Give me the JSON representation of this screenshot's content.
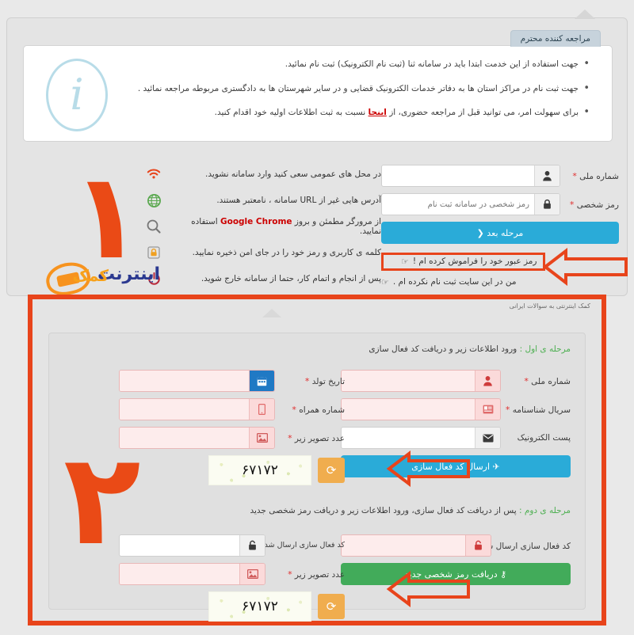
{
  "header": {
    "info_tab_title": "مراجعه کننده محترم",
    "info_icon": "info-circle-icon",
    "bullets": [
      "جهت استفاده از این خدمت ابتدا باید در سامانه ثنا (ثبت نام الکترونیک) ثبت نام نمائید.",
      "جهت ثبت نام در مراکز استان ها به دفاتر خدمات الکترونیک قضایی و در سایر شهرستان ها به دادگستری مربوطه مراجعه نمائید .",
      "برای سهولت امر، می توانید قبل از مراجعه حضوری، از اینجا نسبت به ثبت اطلاعات اولیه خود اقدام کنید."
    ],
    "bullet3_prefix": "برای سهولت امر، می توانید قبل از مراجعه حضوری، از ",
    "bullet3_link": "اینجا",
    "bullet3_suffix": " نسبت به ثبت اطلاعات اولیه خود اقدام کنید."
  },
  "tips": [
    {
      "icon": "wifi-icon",
      "text": "در محل های عمومی سعی کنید وارد سامانه نشوید."
    },
    {
      "icon": "globe-icon",
      "text": "آدرس هایی غیر از URL سامانه ، نامعتبر هستند."
    },
    {
      "icon": "magnifier-icon",
      "prefix": "از مرورگر مطمئن و بروز ",
      "brand": "Google Chrome",
      "suffix": " استفاده نمایید."
    },
    {
      "icon": "lock-icon",
      "text": "کلمه ی کاربری و رمز خود را در جای امن ذخیره نمایید."
    },
    {
      "icon": "power-icon",
      "text": "پس از انجام و اتمام کار، حتما از سامانه خارج شوید."
    }
  ],
  "login": {
    "fields": [
      {
        "label": "شماره ملی",
        "required": true,
        "icon": "user-icon",
        "value": "",
        "placeholder": ""
      },
      {
        "label": "رمز شخصی",
        "required": true,
        "icon": "lock-icon",
        "value": "",
        "placeholder": "رمز شخصی در سامانه ثبت نام"
      }
    ],
    "next_button": "مرحله بعد",
    "next_button_chevron": "❮",
    "next_button_color": "#2aabd8",
    "forgot_link": "رمز عبور خود را فراموش کرده ام !",
    "not_registered_link": "من در این سایت ثبت نام نکرده ام .",
    "hand_icon": "pointing-hand-icon"
  },
  "watermark": {
    "brand": "اینترنت",
    "brand_k": "کمک",
    "tagline": "کمک اینترنتی به سوالات ایرانی",
    "icon": "swoosh-logo-icon"
  },
  "big_numerals": {
    "one": "۱",
    "two": "۲"
  },
  "stage1": {
    "heading_label": "مرحله ی اول :",
    "heading_text": " ورود اطلاعات زیر و دریافت کد فعال سازی",
    "right_fields": [
      {
        "label": "شماره ملی",
        "required": true,
        "icon": "user-icon",
        "value": "",
        "state": "pink"
      },
      {
        "label": "سریال شناسنامه",
        "required": true,
        "icon": "id-card-icon",
        "value": "",
        "state": "pink"
      },
      {
        "label": "پست الکترونیک",
        "required": false,
        "icon": "envelope-icon",
        "value": "",
        "state": "white"
      }
    ],
    "left_fields": [
      {
        "label": "تاریخ تولد",
        "required": true,
        "icon": "calendar-icon",
        "value": "",
        "state": "pink",
        "addon": "blue"
      },
      {
        "label": "شماره همراه",
        "required": true,
        "icon": "mobile-icon",
        "value": "",
        "state": "pink"
      },
      {
        "label": "عدد تصویر زیر",
        "required": true,
        "icon": "image-icon",
        "value": "",
        "state": "pink"
      }
    ],
    "submit_button": "ارسال کد فعال سازی",
    "submit_button_icon": "paper-plane-icon",
    "submit_button_color": "#2aabd8",
    "captcha_value": "۶۷۱۷۲",
    "captcha_refresh_icon": "refresh-icon"
  },
  "stage2": {
    "heading_label": "مرحله ی دوم :",
    "heading_text": " پس از دریافت کد فعال سازی، ورود اطلاعات زیر و دریافت رمز شخصی جدید",
    "right_fields": [
      {
        "label": "کد فعال سازی ارسال شده به شماره همراه",
        "required": true,
        "icon": "unlock-icon",
        "value": "",
        "state": "pink"
      }
    ],
    "left_fields": [
      {
        "label": "کد فعال سازی ارسال شده به پست الکترونیک",
        "required": false,
        "icon": "lock-open-icon",
        "value": "",
        "state": "white"
      },
      {
        "label": "عدد تصویر زیر",
        "required": true,
        "icon": "image-icon",
        "value": "",
        "state": "pink"
      }
    ],
    "submit_button": "دریافت رمز شخصی جدید",
    "submit_button_icon": "key-icon",
    "submit_button_color": "#42ab5a",
    "captcha_value": "۶۷۱۷۲",
    "captcha_refresh_icon": "refresh-icon"
  },
  "annotation": {
    "color": "#e8441b",
    "arrow_icon": "left-arrow-annotation"
  }
}
